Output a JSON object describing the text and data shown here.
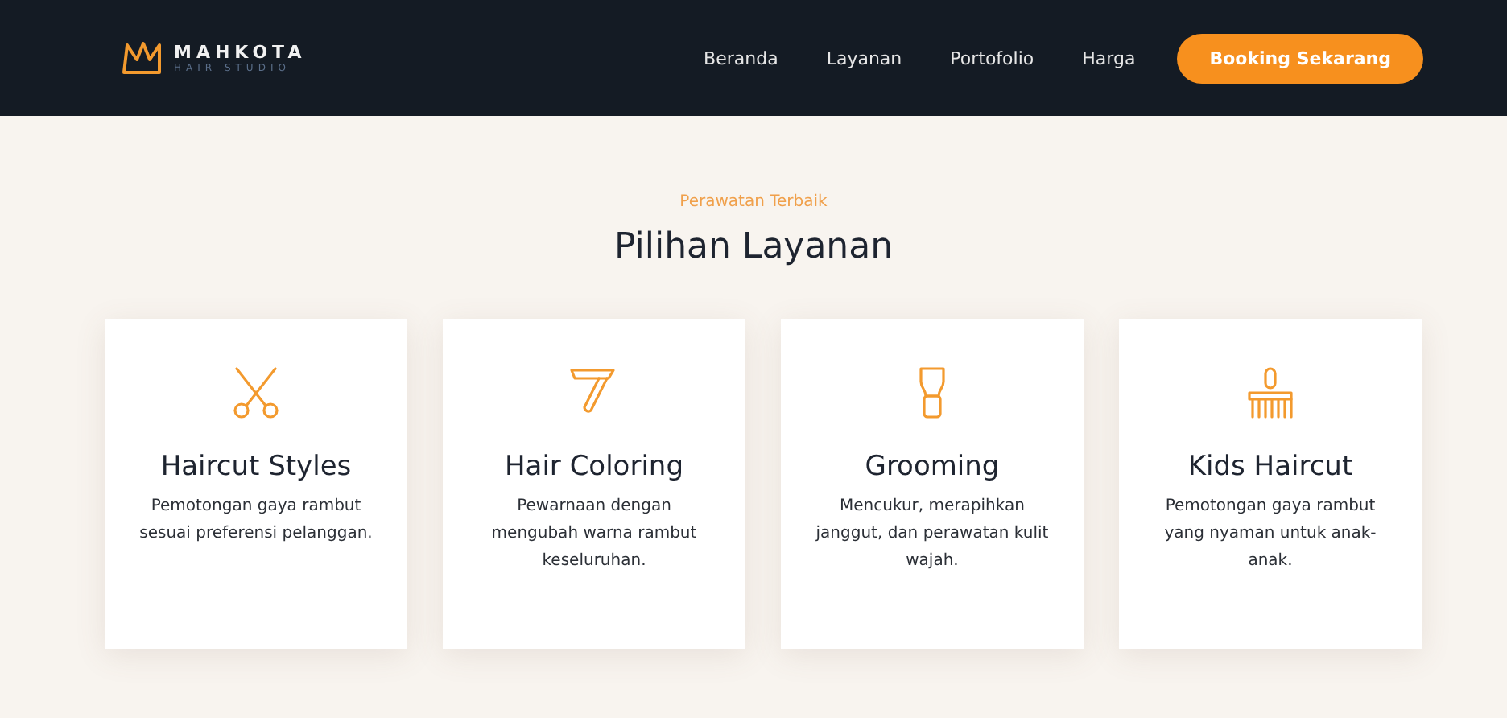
{
  "navbar": {
    "logo": {
      "name": "MAHKOTA",
      "tagline": "HAIR STUDIO"
    },
    "links": [
      {
        "label": "Beranda"
      },
      {
        "label": "Layanan"
      },
      {
        "label": "Portofolio"
      },
      {
        "label": "Harga"
      }
    ],
    "cta": "Booking Sekarang"
  },
  "section": {
    "eyebrow": "Perawatan Terbaik",
    "title": "Pilihan Layanan"
  },
  "services": [
    {
      "kind": "scissors",
      "title": "Haircut Styles",
      "description": "Pemotongan gaya rambut sesuai preferensi pelanggan."
    },
    {
      "kind": "razor",
      "title": "Hair Coloring",
      "description": "Pewarnaan dengan mengubah warna rambut keseluruhan."
    },
    {
      "kind": "brush",
      "title": "Grooming",
      "description": "Mencukur, merapihkan janggut, dan perawatan kulit wajah."
    },
    {
      "kind": "comb",
      "title": "Kids Haircut",
      "description": "Pemotongan gaya rambut yang nyaman untuk anak-anak."
    }
  ]
}
